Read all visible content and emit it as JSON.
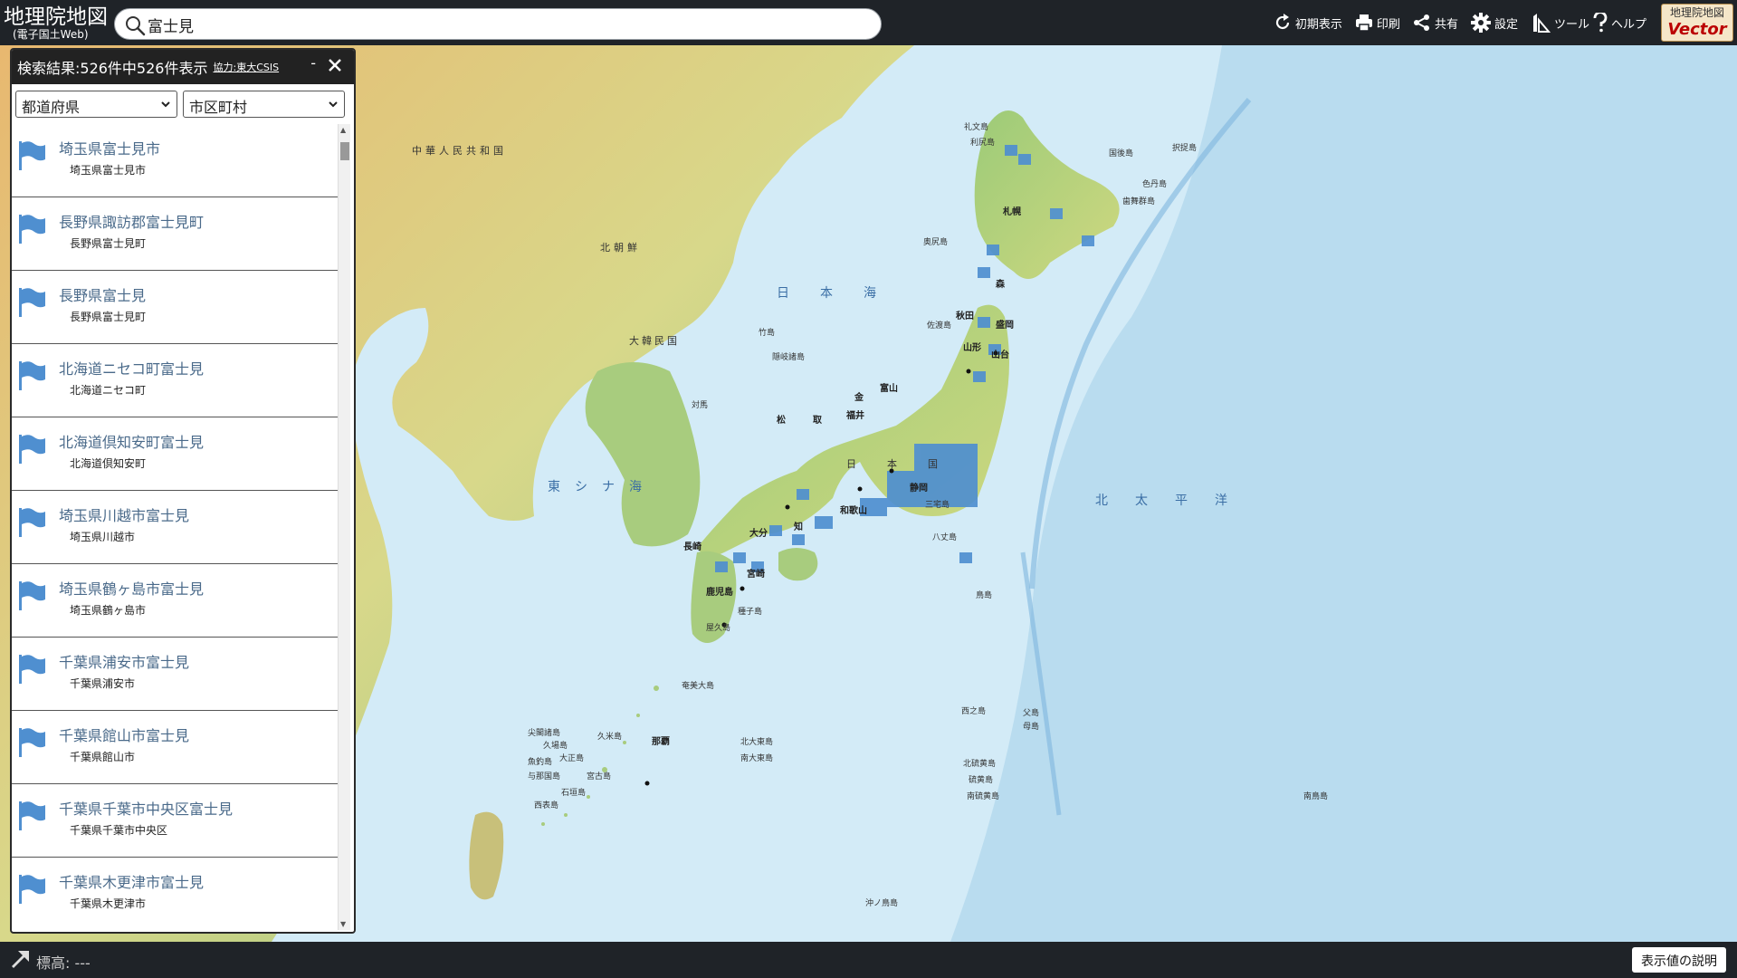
{
  "app": {
    "logo_line1": "地理院地図",
    "logo_line2": "(電子国土Web)",
    "vector_line1": "地理院地図",
    "vector_line2": "Vector"
  },
  "search": {
    "value": "富士見",
    "icon": "search-icon"
  },
  "toolbar": {
    "reset": "初期表示",
    "print": "印刷",
    "share": "共有",
    "settings": "設定",
    "tools": "ツール",
    "help": "ヘルプ"
  },
  "panel": {
    "title": "検索結果:526件中526件表示",
    "credit": "協力:東大CSIS",
    "minimize": "-",
    "prefecture_select": "都道府県",
    "city_select": "市区町村",
    "results": [
      {
        "name": "埼玉県富士見市",
        "sub": "埼玉県富士見市"
      },
      {
        "name": "長野県諏訪郡富士見町",
        "sub": "長野県富士見町"
      },
      {
        "name": "長野県富士見",
        "sub": "長野県富士見町"
      },
      {
        "name": "北海道ニセコ町富士見",
        "sub": "北海道ニセコ町"
      },
      {
        "name": "北海道倶知安町富士見",
        "sub": "北海道倶知安町"
      },
      {
        "name": "埼玉県川越市富士見",
        "sub": "埼玉県川越市"
      },
      {
        "name": "埼玉県鶴ヶ島市富士見",
        "sub": "埼玉県鶴ヶ島市"
      },
      {
        "name": "千葉県浦安市富士見",
        "sub": "千葉県浦安市"
      },
      {
        "name": "千葉県館山市富士見",
        "sub": "千葉県館山市"
      },
      {
        "name": "千葉県千葉市中央区富士見",
        "sub": "千葉県千葉市中央区"
      },
      {
        "name": "千葉県木更津市富士見",
        "sub": "千葉県木更津市"
      }
    ]
  },
  "map": {
    "labels": {
      "china": "中華人民共和国",
      "north_korea": "北朝鮮",
      "south_korea": "大韓民国",
      "sea_of_japan": "日本海",
      "east_china_sea": "東シナ海",
      "japan": "日本国",
      "pacific": "北太平洋"
    },
    "cities": {
      "sapporo": "札幌",
      "aomori": "森",
      "morioka": "盛岡",
      "akita": "秋田",
      "yamagata": "山形",
      "sendai": "山台",
      "kanazawa": "金",
      "toyama": "富山",
      "fukui": "福井",
      "tottori": "取",
      "matsue": "松",
      "shizuoka": "静岡",
      "wakayama": "和歌山",
      "nagasaki": "長崎",
      "oita": "大分",
      "miyazaki": "宮崎",
      "kagoshima": "鹿児島",
      "kochi": "知",
      "naha": "那覇"
    },
    "islands": {
      "rebun": "礼文島",
      "rishiri": "利尻島",
      "okushiri": "奥尻島",
      "kunashiri": "国後島",
      "etorofu": "択捉島",
      "shikotan": "色丹島",
      "habomai": "歯舞群島",
      "sado": "佐渡島",
      "oki": "隠岐諸島",
      "takeshima": "竹島",
      "tsushima": "対馬",
      "miyake": "三宅島",
      "hachijo": "八丈島",
      "tori": "鳥島",
      "tanegashima": "種子島",
      "yakushima": "屋久島",
      "amami": "奄美大島",
      "minamidaito": "南大東島",
      "kitadaito": "北大東島",
      "okinotori": "沖ノ鳥島",
      "chichijima": "父島",
      "hahajima": "母島",
      "nishinoshima": "西之島",
      "minamitori": "南鳥島",
      "kitaiwo": "北硫黄島",
      "iwo": "硫黄島",
      "minamiiwo": "南硫黄島",
      "senkaku": "尖閣諸島",
      "ishigaki": "石垣島",
      "yonaguni": "与那国島",
      "iriomote": "西表島",
      "miyako": "宮古島",
      "kumejima": "久米島",
      "taisho": "大正島",
      "kuba": "久場島",
      "uotsuri": "魚釣島"
    }
  },
  "footer": {
    "elevation": "標高: ---",
    "legend_button": "表示値の説明"
  },
  "colors": {
    "header_bg": "#1f2328",
    "flag_blue": "#4f8fd0",
    "result_text": "#4a6a8a"
  }
}
